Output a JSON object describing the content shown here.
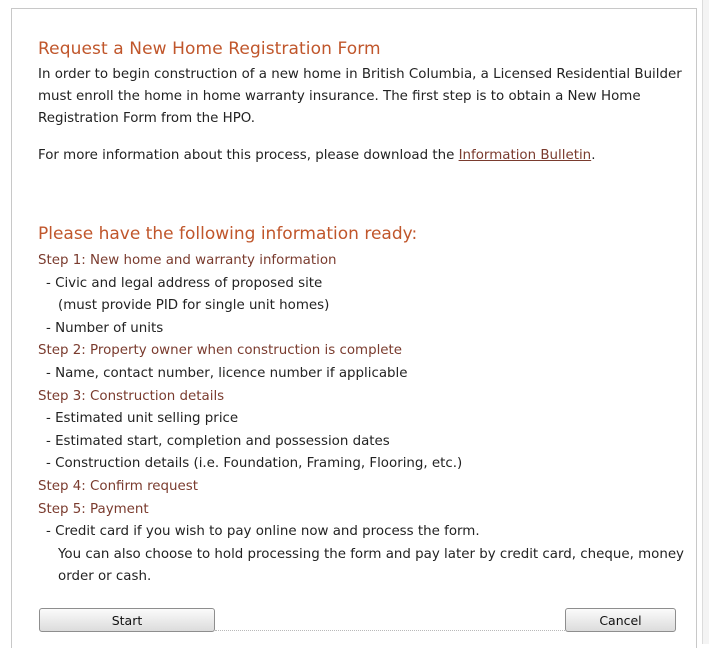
{
  "heading": "Request a New Home Registration Form",
  "intro": "In order to begin construction of a new home in British Columbia, a Licensed Residential Builder must enroll the home in home warranty insurance. The first step is to obtain a New Home Registration Form from the HPO.",
  "more_info": {
    "prefix": "For more information about this process, please download the ",
    "link_label": "Information Bulletin",
    "suffix": "."
  },
  "section_title": "Please have the following information ready:",
  "steps": [
    {
      "title": "Step 1: New home and warranty information",
      "items": [
        "- Civic and legal address of proposed site",
        "(must provide PID for single unit homes)",
        "- Number of units"
      ]
    },
    {
      "title": "Step 2: Property owner when construction is complete",
      "items": [
        "- Name, contact number, licence number if applicable"
      ]
    },
    {
      "title": "Step 3: Construction details",
      "items": [
        "- Estimated unit selling price",
        "- Estimated start, completion and possession dates",
        "- Construction details (i.e. Foundation, Framing, Flooring, etc.)"
      ]
    },
    {
      "title": "Step 4: Confirm request",
      "items": []
    },
    {
      "title": "Step 5: Payment",
      "items": [
        "- Credit card if you wish to pay online now and process the form."
      ],
      "note": "You can also choose to hold processing the form and pay later by credit card, cheque, money order or cash."
    }
  ],
  "buttons": {
    "start": "Start",
    "cancel": "Cancel"
  }
}
